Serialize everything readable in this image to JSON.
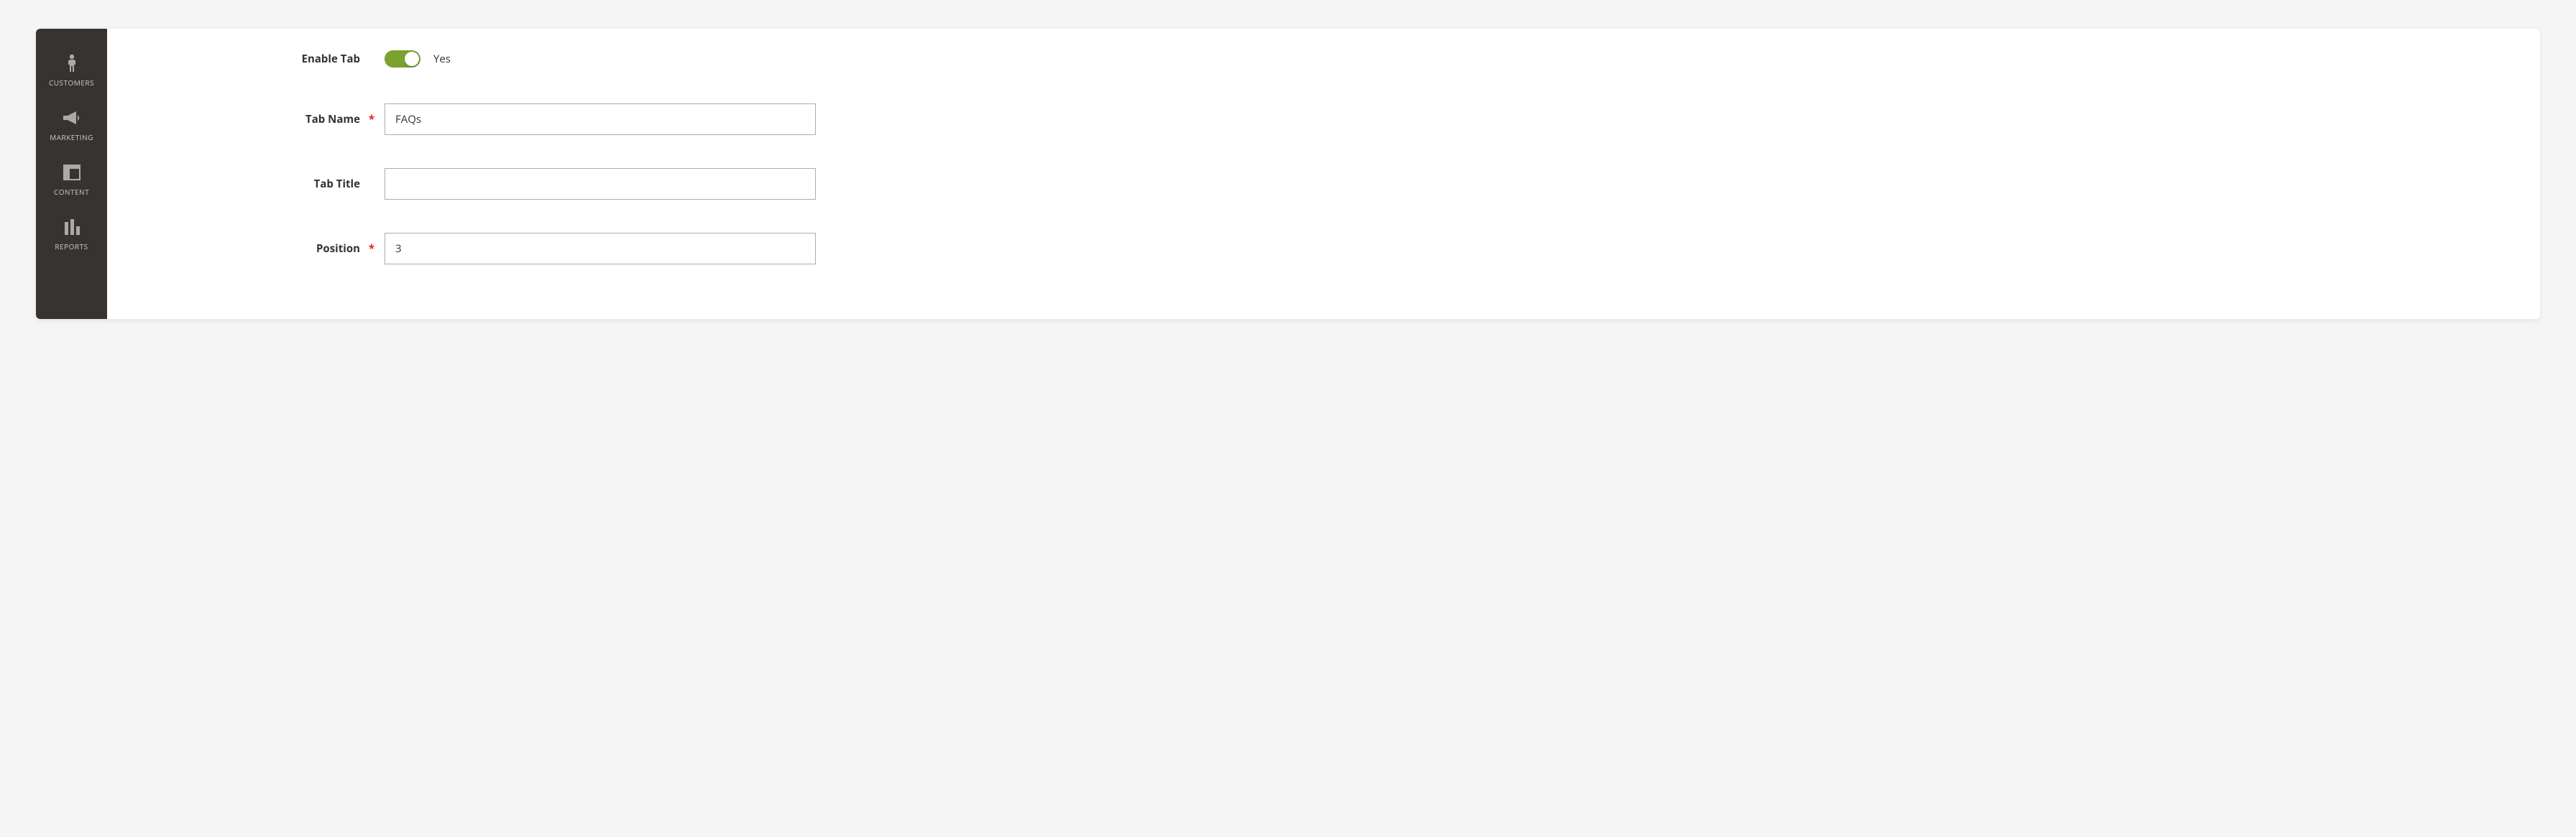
{
  "sidebar": {
    "items": [
      {
        "label": "CUSTOMERS",
        "icon": "person-icon"
      },
      {
        "label": "MARKETING",
        "icon": "megaphone-icon"
      },
      {
        "label": "CONTENT",
        "icon": "layout-icon"
      },
      {
        "label": "REPORTS",
        "icon": "bar-chart-icon"
      }
    ]
  },
  "form": {
    "enable_tab": {
      "label": "Enable Tab",
      "value": true,
      "value_label": "Yes"
    },
    "tab_name": {
      "label": "Tab Name",
      "required": true,
      "value": "FAQs"
    },
    "tab_title": {
      "label": "Tab Title",
      "required": false,
      "value": ""
    },
    "position": {
      "label": "Position",
      "required": true,
      "value": "3"
    }
  }
}
